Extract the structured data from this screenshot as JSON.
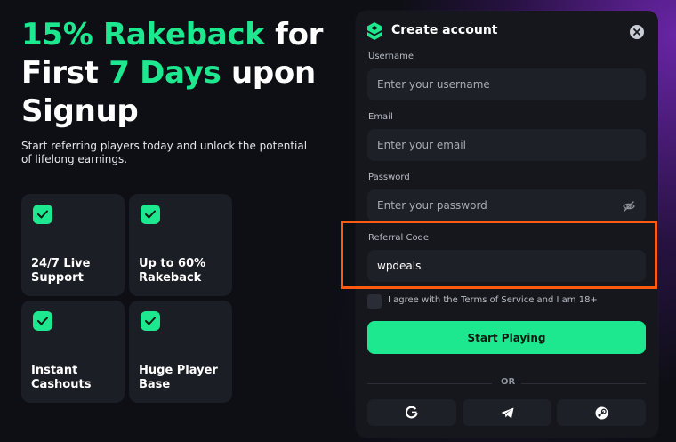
{
  "hero": {
    "title_line1_accent": "15% Rakeback",
    "title_line1_rest": " for",
    "title_line2_start": "First ",
    "title_line2_accent": "7 Days",
    "title_line2_rest": " upon",
    "title_line3": "Signup",
    "subtitle": "Start referring players today and unlock the potential of lifelong earnings."
  },
  "features": [
    {
      "label": "24/7 Live Support",
      "icon": "check-icon"
    },
    {
      "label": "Up to 60% Rakeback",
      "icon": "check-icon"
    },
    {
      "label": "Instant Cashouts",
      "icon": "check-icon"
    },
    {
      "label": "Huge Player Base",
      "icon": "check-icon"
    }
  ],
  "modal": {
    "title": "Create account",
    "username_label": "Username",
    "username_placeholder": "Enter your username",
    "email_label": "Email",
    "email_placeholder": "Enter your email",
    "password_label": "Password",
    "password_placeholder": "Enter your password",
    "referral_label": "Referral Code",
    "referral_value": "wpdeals",
    "terms_text": "I agree with the Terms of Service and I am 18+",
    "submit_label": "Start Playing",
    "or_text": "OR",
    "social": [
      "google-icon",
      "telegram-icon",
      "steam-icon"
    ]
  },
  "colors": {
    "accent": "#1ee88f",
    "highlight": "#ff5a10",
    "background": "#0d0f14",
    "panel": "#15171d"
  }
}
